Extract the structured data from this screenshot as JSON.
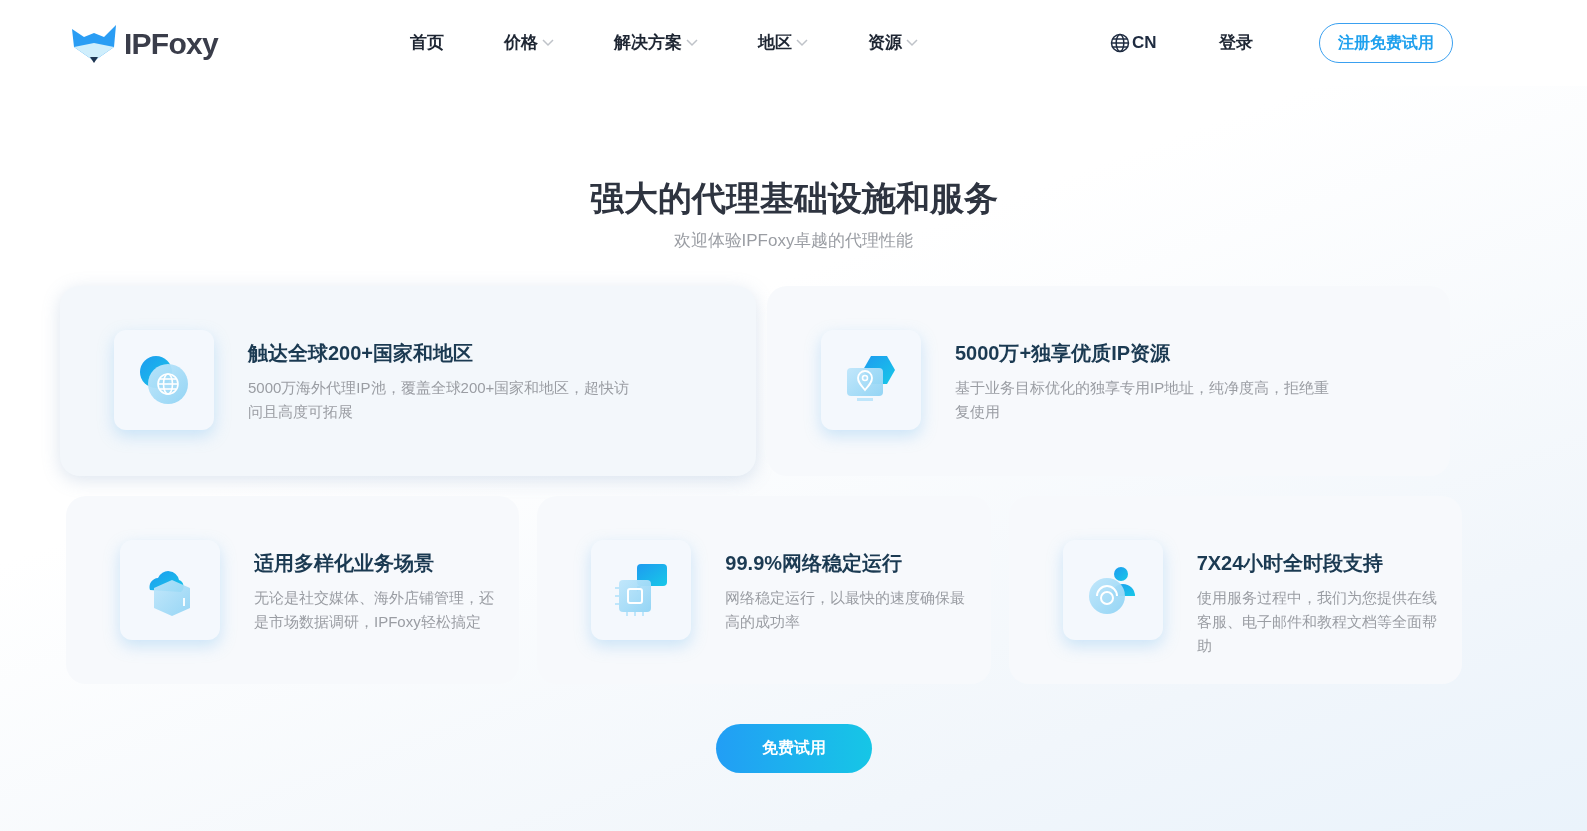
{
  "header": {
    "logo_text": "IPFoxy",
    "nav": [
      {
        "label": "首页",
        "dropdown": false
      },
      {
        "label": "价格",
        "dropdown": true
      },
      {
        "label": "解决方案",
        "dropdown": true
      },
      {
        "label": "地区",
        "dropdown": true
      },
      {
        "label": "资源",
        "dropdown": true
      }
    ],
    "language": "CN",
    "login": "登录",
    "signup": "注册免费试用"
  },
  "hero": {
    "title": "强大的代理基础设施和服务",
    "subtitle": "欢迎体验IPFoxy卓越的代理性能"
  },
  "features": [
    {
      "kind": "globe",
      "title": "触达全球200+国家和地区",
      "description": "5000万海外代理IP池，覆盖全球200+国家和地区，超快访问且高度可拓展",
      "elevated": true
    },
    {
      "kind": "location",
      "title": "5000万+独享优质IP资源",
      "description": "基于业务目标优化的独享专用IP地址，纯净度高，拒绝重复使用",
      "elevated": false
    },
    {
      "kind": "cube",
      "title": "适用多样化业务场景",
      "description": "无论是社交媒体、海外店铺管理，还是市场数据调研，IPFoxy轻松搞定",
      "elevated": false
    },
    {
      "kind": "chip",
      "title": "99.9%网络稳定运行",
      "description": "网络稳定运行，以最快的速度确保最高的成功率",
      "elevated": false
    },
    {
      "kind": "support",
      "title": "7X24小时全时段支持",
      "description": "使用服务过程中，我们为您提供在线客服、电子邮件和教程文档等全面帮助",
      "elevated": false
    }
  ],
  "cta": "免费试用"
}
